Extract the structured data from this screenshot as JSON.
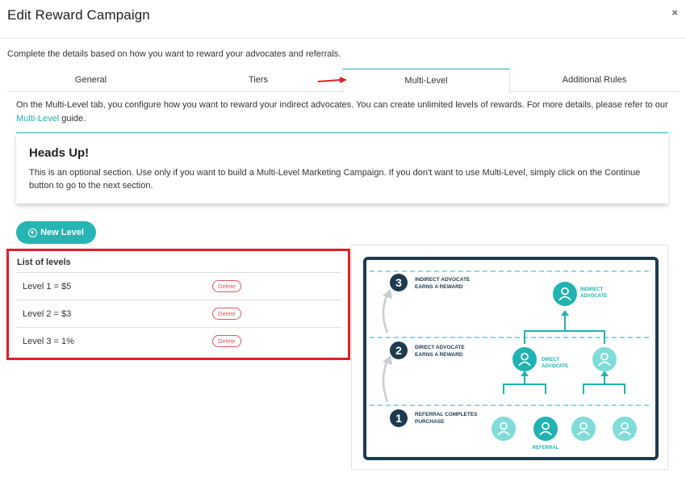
{
  "modal": {
    "title": "Edit Reward Campaign",
    "close_symbol": "×"
  },
  "intro_text": "Complete the details based on how you want to reward your advocates and referrals.",
  "tabs": [
    {
      "label": "General",
      "active": false
    },
    {
      "label": "Tiers",
      "active": false
    },
    {
      "label": "Multi-Level",
      "active": true
    },
    {
      "label": "Additional Rules",
      "active": false
    }
  ],
  "tab_description": {
    "text": "On the Multi-Level tab, you configure how you want to reward your indirect advocates. You can create unlimited levels of rewards. For more details, please refer to our ",
    "link_text": "Multi-Level",
    "suffix": " guide."
  },
  "heads_up": {
    "title": "Heads Up!",
    "text": "This is an optional section. Use only if you want to build a Multi-Level Marketing Campaign. If you don't want to use Multi-Level, simply click on the Continue button to go to the next section."
  },
  "new_level_button": "New Level",
  "levels": {
    "title": "List of levels",
    "items": [
      {
        "label": "Level 1 = $5",
        "delete_label": "Delete"
      },
      {
        "label": "Level 2 = $3",
        "delete_label": "Delete"
      },
      {
        "label": "Level 3 = 1%",
        "delete_label": "Delete"
      }
    ]
  },
  "diagram": {
    "steps": [
      {
        "number": "3",
        "line1": "INDIRECT ADVOCATE",
        "line2": "EARNS A REWARD"
      },
      {
        "number": "2",
        "line1": "DIRECT ADVOCATE",
        "line2": "EARNS A REWARD"
      },
      {
        "number": "1",
        "line1": "REFERRAL COMPLETES",
        "line2": "PURCHASE"
      }
    ],
    "node_labels": {
      "indirect_line1": "INDIRECT",
      "indirect_line2": "ADVOCATE",
      "direct_line1": "DIRECT",
      "direct_line2": "ADVOCATE",
      "referral": "REFERRAL"
    },
    "colors": {
      "frame": "#1d3a4f",
      "accent": "#21b3b1",
      "light": "#7fdcd9"
    }
  },
  "colors": {
    "accent": "#26b5b2",
    "highlight_border": "#e01f26",
    "delete": "#e0595e"
  }
}
